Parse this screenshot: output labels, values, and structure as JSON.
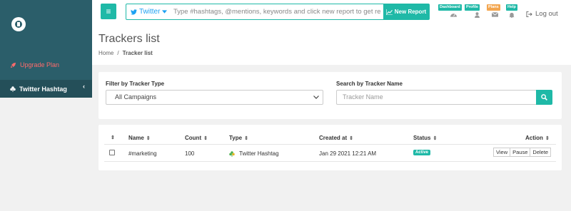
{
  "sidebar": {
    "upgrade_label": "Upgrade Plan",
    "active_item_label": "Twitter Hashtag",
    "collapse_glyph": "‹"
  },
  "topbar": {
    "menu_glyph": "≡",
    "platform": "Twitter",
    "search_placeholder": "Type #hashtags, @mentions, keywords and click new report to get report",
    "new_report_label": "New Report",
    "badges": {
      "dashboard": "Dashboard",
      "profile": "Profile",
      "plans": "Plans",
      "help": "Help"
    },
    "logout_label": "Log out"
  },
  "page": {
    "title": "Trackers list",
    "breadcrumb": {
      "home": "Home",
      "separator": "/",
      "current": "Tracker list"
    }
  },
  "filters": {
    "type_label": "Filter by Tracker Type",
    "type_selected": "All Campaigns",
    "name_label": "Search by Tracker Name",
    "name_placeholder": "Tracker Name"
  },
  "table": {
    "columns": {
      "name": "Name",
      "count": "Count",
      "type": "Type",
      "created": "Created at",
      "status": "Status",
      "action": "Action"
    },
    "rows": [
      {
        "name": "#marketing",
        "count": "100",
        "type": "Twitter Hashtag",
        "created_at": "Jan 29 2021 12:21 AM",
        "status": "Active",
        "actions": {
          "view": "View",
          "pause": "Pause",
          "delete": "Delete"
        }
      }
    ]
  },
  "colors": {
    "accent": "#1fb9a7",
    "sidebar": "#2b5e6a",
    "upgrade": "#ff6b6b",
    "plans": "#f3a64f",
    "twitter": "#1da1f2"
  },
  "icons": [
    "logo-icon",
    "rocket-icon",
    "clover-icon",
    "chevron-left-icon",
    "menu-icon",
    "twitter-icon",
    "caret-down-icon",
    "chart-icon",
    "dashboard-icon",
    "user-icon",
    "envelope-icon",
    "bell-icon",
    "logout-icon",
    "search-icon",
    "sort-icon",
    "checkbox-icon"
  ]
}
